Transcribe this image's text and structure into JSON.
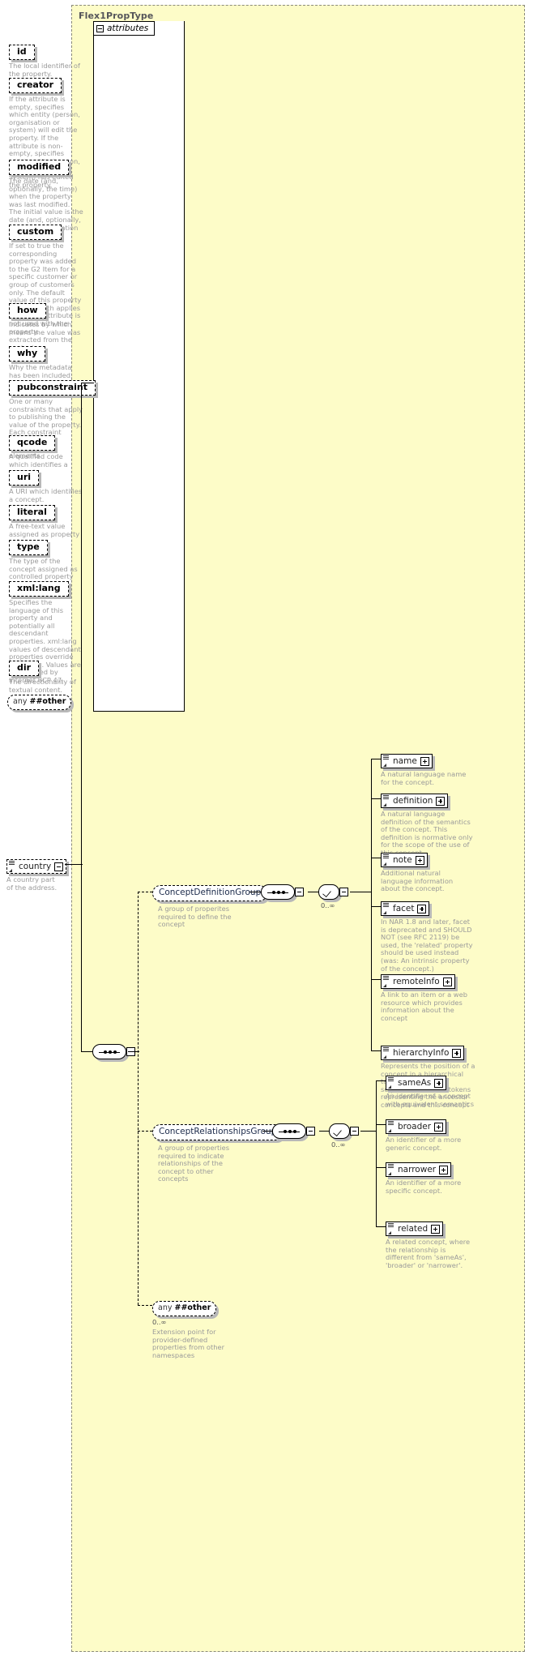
{
  "diagram": {
    "type_name": "Flex1PropType",
    "attributes_label": "attributes",
    "any_label_prefix": "any",
    "any_label_bold": "##other"
  },
  "attributes": [
    {
      "name": "id",
      "desc": "The local identifier of the property."
    },
    {
      "name": "creator",
      "desc": "If the attribute is empty, specifies which entity (person, organisation or system) will edit the property. If the attribute is non-empty, specifies which entity (person, organisation or system) has edited the property."
    },
    {
      "name": "modified",
      "desc": "The date (and, optionally, the time) when the property was last modified. The initial value is the date (and, optionally, the time) of creation of the property."
    },
    {
      "name": "custom",
      "desc": "If set to true the corresponding property was added to the G2 Item for a specific customer or group of customers only. The default value of this property is false which applies when this attribute is not used with the property."
    },
    {
      "name": "how",
      "desc": "Indicates by which means the value was extracted from the content."
    },
    {
      "name": "why",
      "desc": "Why the metadata has been included."
    },
    {
      "name": "pubconstraint",
      "desc": "One or many constraints that apply to publishing the value of the property. Each constraint applies to all descendant elements."
    },
    {
      "name": "qcode",
      "desc": "A qualified code which identifies a concept."
    },
    {
      "name": "uri",
      "desc": "A URI which identifies a concept."
    },
    {
      "name": "literal",
      "desc": "A free-text value assigned as property value."
    },
    {
      "name": "type",
      "desc": "The type of the concept assigned as controlled property value."
    },
    {
      "name": "xml:lang",
      "desc": "Specifies the language of this property and potentially all descendant properties. xml:lang values of descendant properties override this value. Values are determined by Internet BCP 47."
    },
    {
      "name": "dir",
      "desc": "The directionality of textual content."
    }
  ],
  "country": {
    "name": "country",
    "desc": "A country part of the address."
  },
  "groups": [
    {
      "id": "concept-definition-group",
      "name": "ConceptDefinitionGroup",
      "desc": "A group of properites required to define the concept",
      "occurs": "0..∞",
      "elements": [
        {
          "name": "name",
          "desc": "A natural language name for the concept."
        },
        {
          "name": "definition",
          "desc": "A natural language definition of the semantics of the concept. This definition is normative only for the scope of the use of this concept."
        },
        {
          "name": "note",
          "desc": "Additional natural language information about the concept."
        },
        {
          "name": "facet",
          "desc": "In NAR 1.8 and later, facet is deprecated and SHOULD NOT (see RFC 2119) be used, the 'related' property should be used instead (was: An intrinsic property of the concept.)"
        },
        {
          "name": "remoteInfo",
          "desc": "A link to an item or a web resource which provides information about the concept"
        },
        {
          "name": "hierarchyInfo",
          "desc": "Represents the position of a concept in a hierarchical taxonomy tree by a sequence of QCode tokens representing the ancestor concepts and this concept"
        }
      ]
    },
    {
      "id": "concept-relationships-group",
      "name": "ConceptRelationshipsGroup",
      "desc": "A group of properties required to indicate relationships of the concept to other concepts",
      "occurs": "0..∞",
      "elements": [
        {
          "name": "sameAs",
          "desc": "An identifier of a concept with equivalent semantics"
        },
        {
          "name": "broader",
          "desc": "An identifier of a more generic concept."
        },
        {
          "name": "narrower",
          "desc": "An identifier of a more specific concept."
        },
        {
          "name": "related",
          "desc": "A related concept, where the relationship is different from 'sameAs', 'broader' or 'narrower'."
        }
      ]
    }
  ],
  "extension": {
    "label_prefix": "any",
    "label_bold": "##other",
    "occurs": "0..∞",
    "desc": "Extension point for provider-defined properties from other namespaces"
  },
  "colors": {
    "type_background": "#fdfcc8",
    "panel_background": "#ffffff",
    "description_text": "#9a9a9a",
    "title_text": "#55555a",
    "group_text": "#1b2a4a",
    "shadow": "#b8b8b8"
  }
}
